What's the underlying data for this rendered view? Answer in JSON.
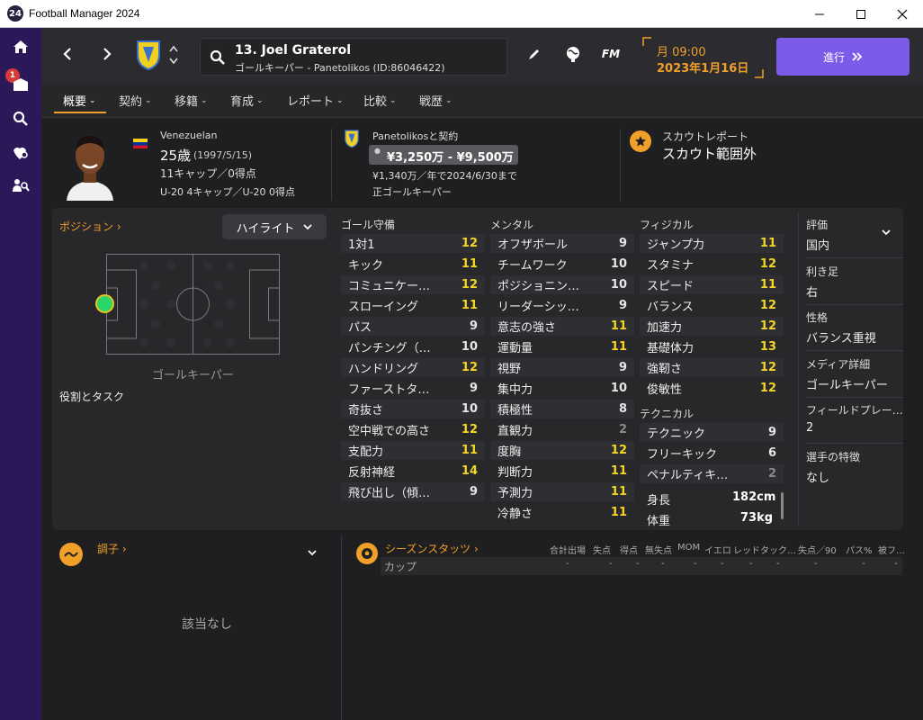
{
  "window": {
    "title": "Football Manager 2024",
    "badge": "24"
  },
  "sidebar": {
    "notification_count": "1",
    "icons": [
      "home-icon",
      "inbox-icon",
      "search-icon",
      "scouting-icon",
      "staff-search-icon"
    ]
  },
  "player": {
    "name": "13. Joel Graterol",
    "description": "ゴールキーパー - Panetolikos (ID:86046422)"
  },
  "date": {
    "time": "月 09:00",
    "date": "2023年1月16日"
  },
  "continue": {
    "label": "進行",
    "icon": "double-chevron-icon"
  },
  "tabs": [
    "概要",
    "契約",
    "移籍",
    "育成",
    "レポート",
    "比較",
    "戦歴"
  ],
  "info": {
    "nationality": "Venezuelan",
    "age": "25歳",
    "birth": "(1997/5/15)",
    "caps": "11キャップ／0得点",
    "u20": "U-20 4キャップ／U-20 0得点",
    "contract_title": "Panetolikosと契約",
    "value_range": "¥3,250万 - ¥9,500万",
    "wage": "¥1,340万／年で2024/6/30まで",
    "role": "正ゴールキーパー",
    "scout_title": "スカウトレポート",
    "scout_status": "スカウト範囲外"
  },
  "position_panel": {
    "title": "ポジション",
    "highlight": "ハイライト",
    "position_label": "ゴールキーパー",
    "roles": "役割とタスク"
  },
  "attributes": {
    "goalkeeping": {
      "title": "ゴール守備",
      "rows": [
        {
          "name": "1対1",
          "value": "12"
        },
        {
          "name": "キック",
          "value": "11"
        },
        {
          "name": "コミュニケー…",
          "value": "12"
        },
        {
          "name": "スローイング",
          "value": "11"
        },
        {
          "name": "パス",
          "value": "9"
        },
        {
          "name": "パンチング（…",
          "value": "10"
        },
        {
          "name": "ハンドリング",
          "value": "12"
        },
        {
          "name": "ファーストタ…",
          "value": "9"
        },
        {
          "name": "奇抜さ",
          "value": "10"
        },
        {
          "name": "空中戦での高さ",
          "value": "12"
        },
        {
          "name": "支配力",
          "value": "11"
        },
        {
          "name": "反射神経",
          "value": "14"
        },
        {
          "name": "飛び出し（傾…",
          "value": "9"
        }
      ]
    },
    "mental": {
      "title": "メンタル",
      "rows": [
        {
          "name": "オフザボール",
          "value": "9"
        },
        {
          "name": "チームワーク",
          "value": "10"
        },
        {
          "name": "ポジショニン…",
          "value": "10"
        },
        {
          "name": "リーダーシッ…",
          "value": "9"
        },
        {
          "name": "意志の強さ",
          "value": "11"
        },
        {
          "name": "運動量",
          "value": "11"
        },
        {
          "name": "視野",
          "value": "9"
        },
        {
          "name": "集中力",
          "value": "10"
        },
        {
          "name": "積極性",
          "value": "8"
        },
        {
          "name": "直観力",
          "value": "2"
        },
        {
          "name": "度胸",
          "value": "12"
        },
        {
          "name": "判断力",
          "value": "11"
        },
        {
          "name": "予測力",
          "value": "11"
        },
        {
          "name": "冷静さ",
          "value": "11"
        }
      ]
    },
    "physical": {
      "title": "フィジカル",
      "rows": [
        {
          "name": "ジャンプ力",
          "value": "11"
        },
        {
          "name": "スタミナ",
          "value": "12"
        },
        {
          "name": "スピード",
          "value": "11"
        },
        {
          "name": "バランス",
          "value": "12"
        },
        {
          "name": "加速力",
          "value": "12"
        },
        {
          "name": "基礎体力",
          "value": "13"
        },
        {
          "name": "強靭さ",
          "value": "12"
        },
        {
          "name": "俊敏性",
          "value": "12"
        }
      ]
    },
    "technical": {
      "title": "テクニカル",
      "rows": [
        {
          "name": "テクニック",
          "value": "9"
        },
        {
          "name": "フリーキック",
          "value": "6"
        },
        {
          "name": "ペナルティキ…",
          "value": "2"
        }
      ]
    },
    "height_label": "身長",
    "height": "182cm",
    "weight_label": "体重",
    "weight": "73kg"
  },
  "right_panel": [
    {
      "label": "評価",
      "value": "国内"
    },
    {
      "label": "利き足",
      "value": "右"
    },
    {
      "label": "性格",
      "value": "バランス重視"
    },
    {
      "label": "メディア詳細",
      "value": "ゴールキーパー"
    },
    {
      "label": "フィールドプレー…",
      "value": "2"
    },
    {
      "label": "選手の特徴",
      "value": "なし"
    }
  ],
  "form": {
    "title": "調子",
    "empty": "該当なし"
  },
  "season_stats": {
    "title": "シーズンスタッツ",
    "row_label": "カップ",
    "headers": [
      "合計出場",
      "失点",
      "得点",
      "無失点",
      "MOM",
      "イエロ",
      "レッド",
      "タック…",
      "失点／90",
      "パス%",
      "被フ…"
    ],
    "values": [
      "-",
      "-",
      "-",
      "-",
      "-",
      "-",
      "-",
      "-",
      "-",
      "-",
      "-"
    ]
  }
}
